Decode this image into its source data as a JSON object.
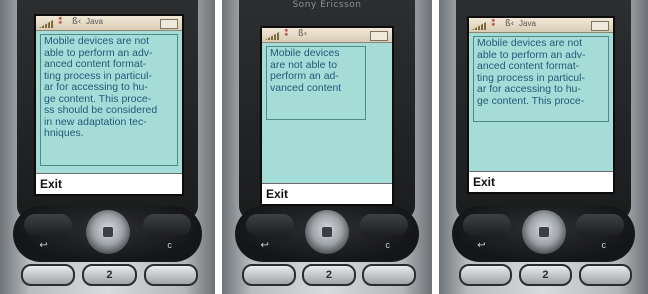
{
  "panels": [
    {
      "brand": "",
      "status": {
        "bt": "⁑",
        "bt2": "ß‹",
        "app": "Java"
      },
      "text": "Mobile devices are not\nable to perform an adv-\nanced content format-\nting process in particul-\nar for accessing to hu-\nge content. This proce-\nss should be considered\nin new adaptation tec-\nhniques.",
      "softkey": "Exit",
      "key_label": "2"
    },
    {
      "brand": "Sony Ericsson",
      "status": {
        "bt": "⁑",
        "bt2": "ß‹",
        "app": ""
      },
      "text": "Mobile devices\nare not able to\nperform an ad-\nvanced content",
      "softkey": "Exit",
      "key_label": "2"
    },
    {
      "brand": "",
      "status": {
        "bt": "⁑",
        "bt2": "ß‹",
        "app": "Java"
      },
      "text": "Mobile devices are not\nable to perform an adv-\nanced content format-\nting process in particul-\nar for accessing to hu-\nge content. This proce-",
      "softkey": "Exit",
      "key_label": "2"
    }
  ],
  "colors": {
    "screen_bg": "#a6dcd8",
    "text": "#1f5a78",
    "bezel": "#1b1c1d"
  }
}
